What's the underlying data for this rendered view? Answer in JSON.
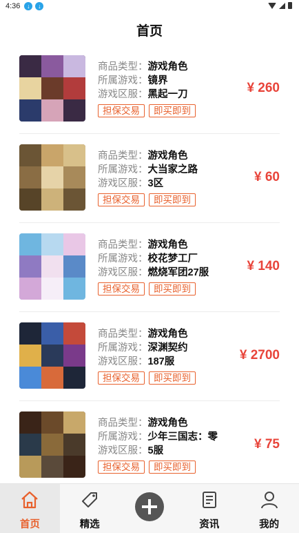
{
  "status_bar": {
    "time": "4:36"
  },
  "header": {
    "title": "首页"
  },
  "labels": {
    "type": "商品类型：",
    "game": "所属游戏：",
    "server": "游戏区服："
  },
  "items": [
    {
      "type": "游戏角色",
      "game": "镜界",
      "server": "黑起一刀",
      "tag1": "担保交易",
      "tag2": "即买即到",
      "price": "¥ 260",
      "thumb_colors": [
        "#3a2a44",
        "#8a5a9e",
        "#c9b8e0",
        "#e8d4a0",
        "#6b3b2a",
        "#b23c3c",
        "#2b3b6b",
        "#d6a4b8"
      ]
    },
    {
      "type": "游戏角色",
      "game": "大当家之路",
      "server": "3区",
      "tag1": "担保交易",
      "tag2": "即买即到",
      "price": "¥ 60",
      "thumb_colors": [
        "#6b5535",
        "#c9a56a",
        "#d8c08a",
        "#8a6d44",
        "#e6d3a8",
        "#a88a5a",
        "#574428",
        "#cdb27a"
      ]
    },
    {
      "type": "游戏角色",
      "game": "校花梦工厂",
      "server": "燃烧军团27服",
      "tag1": "担保交易",
      "tag2": "即买即到",
      "price": "¥ 140",
      "thumb_colors": [
        "#6fb6e0",
        "#b7d9f0",
        "#e9c7e6",
        "#8f7ac2",
        "#f1e0ef",
        "#5a8ac8",
        "#d3a8d8",
        "#f6eef8"
      ]
    },
    {
      "type": "游戏角色",
      "game": "深渊契约",
      "server": "187服",
      "tag1": "担保交易",
      "tag2": "即买即到",
      "price": "¥ 2700",
      "thumb_colors": [
        "#1e2638",
        "#3a5ea8",
        "#c44a3a",
        "#e0b04a",
        "#2a3a5a",
        "#7a3a8a",
        "#4a8ad8",
        "#d86a3a"
      ]
    },
    {
      "type": "游戏角色",
      "game": "少年三国志：零",
      "server": "5服",
      "tag1": "担保交易",
      "tag2": "即买即到",
      "price": "¥ 75",
      "thumb_colors": [
        "#3a2418",
        "#6b4a2a",
        "#c8a86a",
        "#2a3a4a",
        "#8a6a3a",
        "#4a3a2a",
        "#b89a5a",
        "#5a4a3a"
      ]
    }
  ],
  "nav": [
    {
      "label": "首页",
      "icon": "home-icon",
      "active": true
    },
    {
      "label": "精选",
      "icon": "tag-icon",
      "active": false
    },
    {
      "label": "",
      "icon": "add-circle-icon",
      "active": false
    },
    {
      "label": "资讯",
      "icon": "document-icon",
      "active": false
    },
    {
      "label": "我的",
      "icon": "user-icon",
      "active": false
    }
  ],
  "colors": {
    "accent": "#e8602c",
    "price": "#e8443a",
    "nav_bg": "#f6f6f6"
  }
}
